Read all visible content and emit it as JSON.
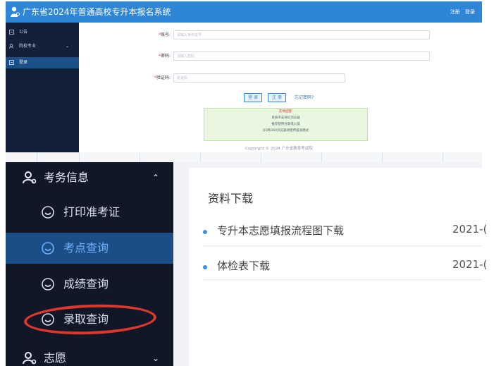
{
  "header": {
    "title": "广东省2024年普通高校专升本报名系统",
    "links": [
      "注册",
      "登录"
    ]
  },
  "sidebar_small": {
    "items": [
      {
        "label": "公告",
        "icon": "notice-icon"
      },
      {
        "label": "院校专业",
        "icon": "school-icon",
        "arrow": "⌄"
      },
      {
        "label": "登录",
        "icon": "login-icon",
        "active": true
      }
    ]
  },
  "login_form": {
    "account_label": "账号:",
    "account_placeholder": "请输入身份证号",
    "password_label": "密码:",
    "password_placeholder": "请输入密码",
    "captcha_label": "验证码:",
    "captcha_placeholder": "验证码",
    "login_button": "登 录",
    "register_button": "注 册",
    "forgot_link": "忘记密码?",
    "notice_title": "友情提醒:",
    "notice_lines": [
      "系统不支持IE浏览器",
      "推荐使用谷歌或火狐",
      "QQ和360浏览器请使用极速模式"
    ],
    "copyright": "Copyright © 2024 广东省教育考试院"
  },
  "sidebar_big": {
    "section_title": "考务信息",
    "section_arrow": "⌃",
    "items": [
      {
        "label": "打印准考证",
        "icon": "face-icon"
      },
      {
        "label": "考点查询",
        "icon": "face-icon",
        "active": true
      },
      {
        "label": "成绩查询",
        "icon": "face-icon"
      },
      {
        "label": "录取查询",
        "icon": "face-icon",
        "highlighted": true
      }
    ],
    "next_section": "志愿",
    "next_arrow": "⌄"
  },
  "downloads": {
    "title": "资料下载",
    "items": [
      {
        "label": "专升本志愿填报流程图下载",
        "date": "2021-("
      },
      {
        "label": "体检表下载",
        "date": "2021-("
      }
    ]
  },
  "colors": {
    "brand_blue": "#2f86d6",
    "sidebar_dark": "#101828",
    "sidebar_active": "#1b4e86",
    "highlight_red": "#e0362c"
  }
}
